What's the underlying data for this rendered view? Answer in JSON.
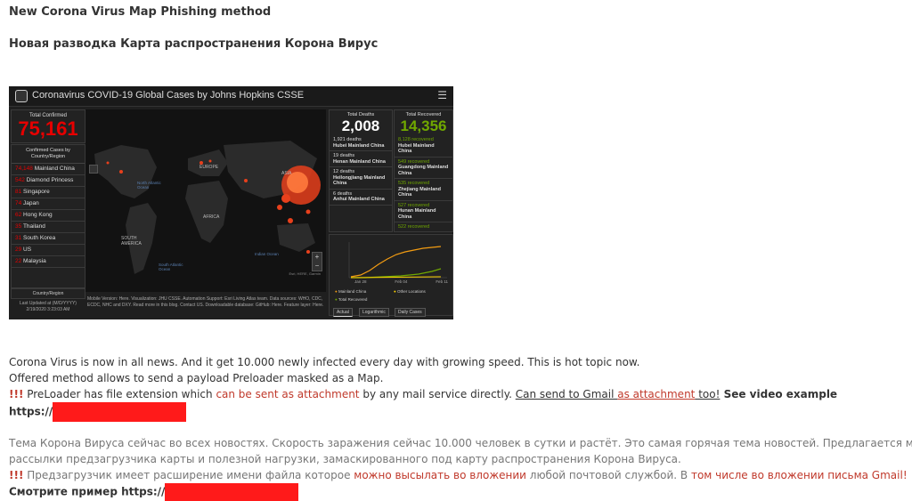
{
  "headings": {
    "en": "New Corona Virus Map Phishing method",
    "ru": "Новая разводка Карта распространения Корона Вирус"
  },
  "dashboard": {
    "title": "Coronavirus COVID-19 Global Cases by Johns Hopkins CSSE",
    "total_confirmed_label": "Total Confirmed",
    "total_confirmed_value": "75,161",
    "country_list_header": "Confirmed Cases by Country/Region",
    "countries": [
      {
        "num": "74,148",
        "name": "Mainland China"
      },
      {
        "num": "542",
        "name": "Diamond Princess"
      },
      {
        "num": "81",
        "name": "Singapore"
      },
      {
        "num": "74",
        "name": "Japan"
      },
      {
        "num": "62",
        "name": "Hong Kong"
      },
      {
        "num": "35",
        "name": "Thailand"
      },
      {
        "num": "31",
        "name": "South Korea"
      },
      {
        "num": "29",
        "name": "US"
      },
      {
        "num": "22",
        "name": "Malaysia"
      }
    ],
    "map_region_label": "Country/Region",
    "last_updated_label": "Last Updated at (M/D/YYYY)",
    "last_updated_value": "2/19/2020 3:23:03 AM",
    "deaths_label": "Total Deaths",
    "deaths_value": "2,008",
    "deaths_rows": [
      {
        "count": "1,921 deaths",
        "place": "Hubei Mainland China"
      },
      {
        "count": "19 deaths",
        "place": "Henan Mainland China"
      },
      {
        "count": "12 deaths",
        "place": "Heilongjiang Mainland China"
      },
      {
        "count": "6 deaths",
        "place": "Anhui Mainland China"
      }
    ],
    "recovered_label": "Total Recovered",
    "recovered_value": "14,356",
    "recovered_rows": [
      {
        "count": "8,128 recovered",
        "place": "Hubei Mainland China"
      },
      {
        "count": "549 recovered",
        "place": "Guangdong Mainland China"
      },
      {
        "count": "535 recovered",
        "place": "Zhejiang Mainland China"
      },
      {
        "count": "527 recovered",
        "place": "Hunan Mainland China"
      },
      {
        "count": "522 recovered",
        "place": ""
      }
    ],
    "map_labels": {
      "europe": "EUROPE",
      "asia": "ASIA",
      "africa": "AFRICA",
      "south_america": "SOUTH AMERICA",
      "north_atlantic": "North Atlantic Ocean",
      "south_atlantic": "South Atlantic Ocean",
      "indian": "Indian Ocean",
      "attribution": "Esri, HERE, Garmin"
    },
    "chart_legend": {
      "mainland": "Mainland China",
      "other": "Other Locations",
      "recovered": "Total Recovered"
    },
    "chart_ticks": [
      "Jan 28",
      "Feb 04",
      "Feb 11"
    ],
    "tabs": [
      "Actual",
      "Logarithmic",
      "Daily Cases"
    ],
    "footer_text": "Mobile Version: Here. Visualization: JHU CSSE. Automation Support: Esri Living Atlas team. Data sources: WHO, CDC, ECDC, NHC and DXY. Read more in this blog. Contact US. Downloadable database: GitHub: Here. Feature layer: Here."
  },
  "body": {
    "en_line1": " Corona Virus is now in all news. And it get 10.000 newly infected every day with growing speed. This is hot topic now.",
    "en_line2": "Offered method allows to send a payload Preloader masked as a Map.",
    "en_bang": "!!!",
    "en_l3_a": " PreLoader has file extension which ",
    "en_l3_b": "can be sent as attachment",
    "en_l3_c": " by any mail service directly. ",
    "en_l3_d": "Can send to Gmail ",
    "en_l3_e": "as attachment",
    "en_l3_f": " too!",
    "en_l3_g": " See video example",
    "en_url": "https://",
    "ru_line1": "   Тема Корона Вируса сейчас во всех новостях. Скорость заражения сейчас 10.000 человек в сутки и растёт. Это самая горячая тема новостей. Предлагается метод",
    "ru_line2": "рассылки предзагрузчика карты и полезной нагрузки, замаскированного под карту распространения Корона Вируса.",
    "ru_bang": "!!!",
    "ru_l3_a": " Предзагрузчик имеет расширение имени файла которое ",
    "ru_l3_b": "можно высылать во вложении",
    "ru_l3_c": " любой почтовой службой. В ",
    "ru_l3_d": "том числе во вложении письма Gmail!",
    "ru_l4": "Смотрите пример https://",
    "redact_color": "#ff1a1a"
  }
}
